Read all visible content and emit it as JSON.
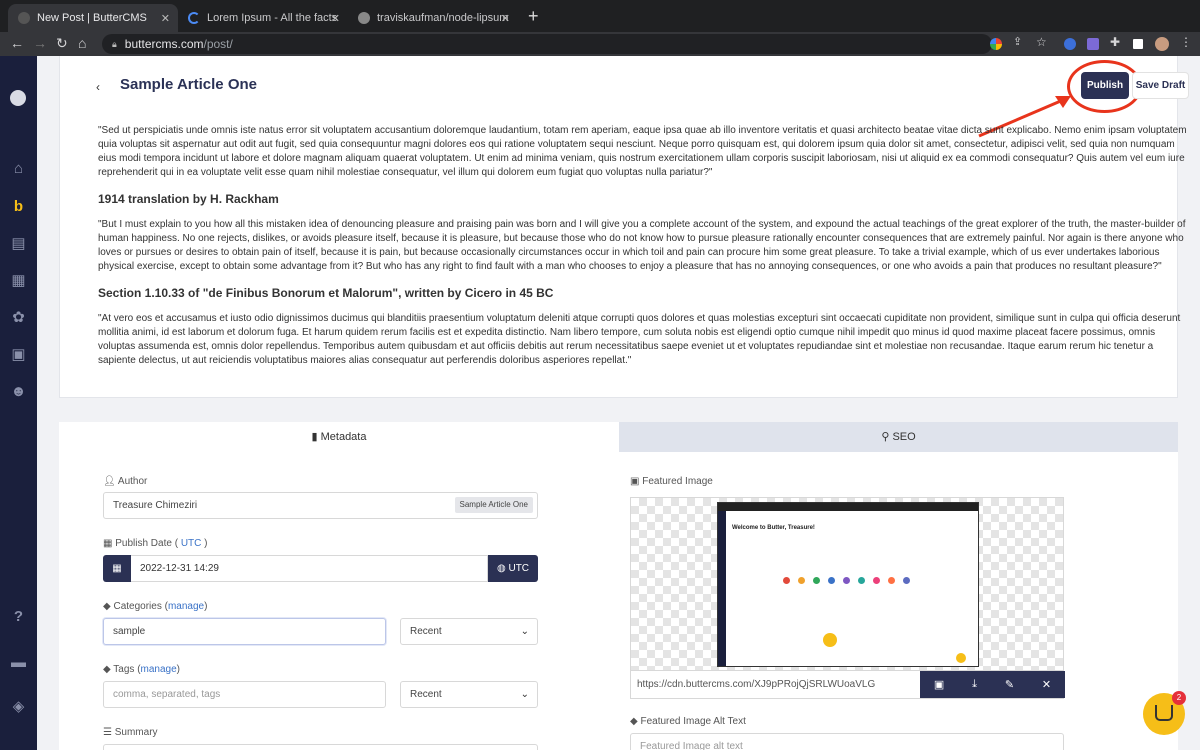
{
  "browser": {
    "tabs": [
      {
        "title": "New Post | ButterCMS",
        "close": "✕"
      },
      {
        "title": "Lorem Ipsum - All the facts - Li",
        "close": "✕"
      },
      {
        "title": "traviskaufman/node-lipsum: lip",
        "close": "✕"
      }
    ],
    "new_tab": "+",
    "url_host": "buttercms.com",
    "url_path": "/post/"
  },
  "sidebar": {
    "icons": [
      "home-icon",
      "butter-logo-icon",
      "pages-icon",
      "collections-icon",
      "components-icon",
      "media-icon",
      "users-icon",
      "help-icon",
      "docs-icon",
      "stack-icon"
    ]
  },
  "header": {
    "back": "‹",
    "title": "Sample Article One",
    "publish_label": "Publish",
    "draft_label": "Save Draft"
  },
  "article": {
    "p1": "\"Sed ut perspiciatis unde omnis iste natus error sit voluptatem accusantium doloremque laudantium, totam rem aperiam, eaque ipsa quae ab illo inventore veritatis et quasi architecto beatae vitae dicta sunt explicabo. Nemo enim ipsam voluptatem quia voluptas sit aspernatur aut odit aut fugit, sed quia consequuntur magni dolores eos qui ratione voluptatem sequi nesciunt. Neque porro quisquam est, qui dolorem ipsum quia dolor sit amet, consectetur, adipisci velit, sed quia non numquam eius modi tempora incidunt ut labore et dolore magnam aliquam quaerat voluptatem. Ut enim ad minima veniam, quis nostrum exercitationem ullam corporis suscipit laboriosam, nisi ut aliquid ex ea commodi consequatur? Quis autem vel eum iure reprehenderit qui in ea voluptate velit esse quam nihil molestiae consequatur, vel illum qui dolorem eum fugiat quo voluptas nulla pariatur?\"",
    "h1": "1914 translation by H. Rackham",
    "p2": "\"But I must explain to you how all this mistaken idea of denouncing pleasure and praising pain was born and I will give you a complete account of the system, and expound the actual teachings of the great explorer of the truth, the master-builder of human happiness. No one rejects, dislikes, or avoids pleasure itself, because it is pleasure, but because those who do not know how to pursue pleasure rationally encounter consequences that are extremely painful. Nor again is there anyone who loves or pursues or desires to obtain pain of itself, because it is pain, but because occasionally circumstances occur in which toil and pain can procure him some great pleasure. To take a trivial example, which of us ever undertakes laborious physical exercise, except to obtain some advantage from it? But who has any right to find fault with a man who chooses to enjoy a pleasure that has no annoying consequences, or one who avoids a pain that produces no resultant pleasure?\"",
    "h2": "Section 1.10.33 of \"de Finibus Bonorum et Malorum\", written by Cicero in 45 BC",
    "p3": "\"At vero eos et accusamus et iusto odio dignissimos ducimus qui blanditiis praesentium voluptatum deleniti atque corrupti quos dolores et quas molestias excepturi sint occaecati cupiditate non provident, similique sunt in culpa qui officia deserunt mollitia animi, id est laborum et dolorum fuga. Et harum quidem rerum facilis est et expedita distinctio. Nam libero tempore, cum soluta nobis est eligendi optio cumque nihil impedit quo minus id quod maxime placeat facere possimus, omnis voluptas assumenda est, omnis dolor repellendus. Temporibus autem quibusdam et aut officiis debitis aut rerum necessitatibus saepe eveniet ut et voluptates repudiandae sint et molestiae non recusandae. Itaque earum rerum hic tenetur a sapiente delectus, ut aut reiciendis voluptatibus maiores alias consequatur aut perferendis doloribus asperiores repellat.\""
  },
  "panel_tabs": {
    "metadata": "Metadata",
    "seo": "SEO"
  },
  "form": {
    "author_label": "Author",
    "author_value": "Treasure Chimeziri",
    "author_chip": "Sample Article One",
    "publish_date_label": "Publish Date (",
    "publish_date_utc_link": "UTC",
    "publish_date_label_end": ")",
    "publish_date_value": "2022-12-31 14:29",
    "publish_date_tz": "UTC",
    "categories_label": "Categories (",
    "categories_manage": "manage",
    "categories_label_end": ")",
    "categories_value": "sample",
    "categories_sort": "Recent",
    "tags_label": "Tags (",
    "tags_manage": "manage",
    "tags_label_end": ")",
    "tags_placeholder": "comma, separated, tags",
    "tags_sort": "Recent",
    "summary_label": "Summary",
    "featured_image_label": "Featured Image",
    "featured_image_url": "https://cdn.buttercms.com/XJ9pPRojQjSRLWUoaVLG",
    "featured_image_thumb_title": "Welcome to Butter, Treasure!",
    "alt_text_label": "Featured Image Alt Text",
    "alt_text_placeholder": "Featured Image alt text"
  },
  "chat": {
    "badge": "2"
  },
  "colors": {
    "brand_navy": "#2b3154",
    "annotation_red": "#e8341c",
    "link_blue": "#3a72c7"
  }
}
